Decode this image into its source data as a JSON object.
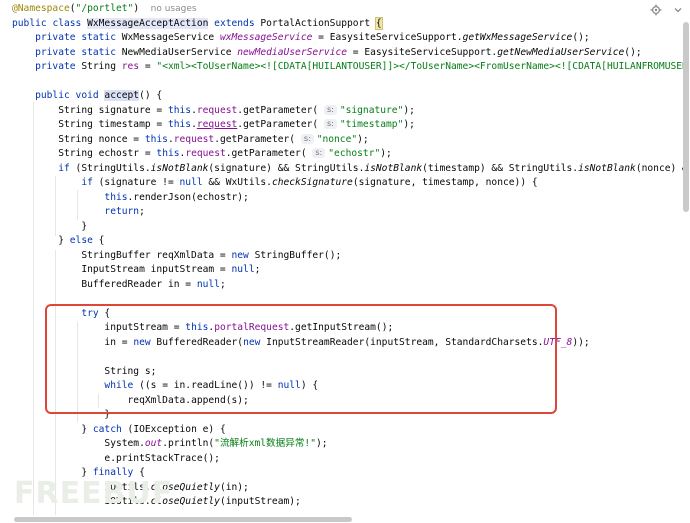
{
  "code": {
    "ann_name": "@Namespace",
    "ann_open": "(",
    "ann_value": "\"/portlet\"",
    "ann_close": ")",
    "usages": "no usages",
    "l2": {
      "public": "public ",
      "class": "class ",
      "name": "WxMessageAcceptAction",
      "extends": " extends ",
      "parent": "PortalActionSupport ",
      "brace": "{"
    },
    "l3": {
      "mods": "private static ",
      "type": "WxMessageService ",
      "field": "wxMessageService",
      "rest1": " = EasysiteServiceSupport.",
      "call": "getWxMessageService",
      "rest2": "();"
    },
    "l4": {
      "mods": "private static ",
      "type": "NewMediaUserService ",
      "field": "newMediaUserService",
      "rest1": " = EasysiteServiceSupport.",
      "call": "getNewMediaUserService",
      "rest2": "();"
    },
    "l5": {
      "mods": "private ",
      "type": "String ",
      "field": "res",
      "rest1": " = ",
      "str": "\"<xml><ToUserName><![CDATA[HUILANTOUSER]]></ToUserName><FromUserName><![CDATA[HUILANFROMUSER]]></FromUserN"
    },
    "l7": {
      "mods": "public void ",
      "method": "accept",
      "rest": "() {"
    },
    "l8": {
      "a": "String signature = ",
      "this": "this",
      "dot": ".",
      "req": "request",
      "call": ".getParameter( ",
      "hint": "s:",
      "arg": "\"signature\"",
      "end": ");"
    },
    "l9": {
      "a": "String timestamp = ",
      "this": "this",
      "dot": ".",
      "req": "request",
      "call": ".getParameter( ",
      "hint": "s:",
      "arg": "\"timestamp\"",
      "end": ");"
    },
    "l10": {
      "a": "String nonce = ",
      "this": "this",
      "dot": ".",
      "req": "request",
      "call": ".getParameter( ",
      "hint": "s:",
      "arg": "\"nonce\"",
      "end": ");"
    },
    "l11": {
      "a": "String echostr = ",
      "this": "this",
      "dot": ".",
      "req": "request",
      "call": ".getParameter( ",
      "hint": "s:",
      "arg": "\"echostr\"",
      "end": ");"
    },
    "l12": {
      "if": "if ",
      "a": "(StringUtils.",
      "m1": "isNotBlank",
      "b": "(signature) && StringUtils.",
      "m2": "isNotBlank",
      "c": "(timestamp) && StringUtils.",
      "m3": "isNotBlank",
      "d": "(nonce) && StringUtils."
    },
    "l13": {
      "if": "if ",
      "a": "(signature != ",
      "null": "null",
      "b": " && WxUtils.",
      "m": "checkSignature",
      "c": "(signature, timestamp, nonce)) {"
    },
    "l14": {
      "this": "this",
      "rest": ".renderJson(echostr);"
    },
    "l15": {
      "kw": "return",
      "rest": ";"
    },
    "l16": "}",
    "l17": {
      "a": "} ",
      "else": "else",
      "b": " {"
    },
    "l18": {
      "a": "StringBuffer reqXmlData = ",
      "new": "new",
      "b": " StringBuffer();"
    },
    "l19": {
      "a": "InputStream inputStream = ",
      "null": "null",
      "b": ";"
    },
    "l20": {
      "a": "BufferedReader in = ",
      "null": "null",
      "b": ";"
    },
    "l22": {
      "kw": "try",
      "rest": " {"
    },
    "l23": {
      "a": "inputStream = ",
      "this": "this",
      "dot": ".",
      "field": "portalRequest",
      "b": ".getInputStream();"
    },
    "l24": {
      "a": "in = ",
      "new1": "new",
      "b": " BufferedReader(",
      "new2": "new",
      "c": " InputStreamReader(inputStream, StandardCharsets.",
      "cs": "UTF_8",
      "d": "));"
    },
    "l26": "String s;",
    "l27": {
      "kw": "while",
      "a": " ((s = in.readLine()) != ",
      "null": "null",
      "b": ") {"
    },
    "l28": "reqXmlData.append(s);",
    "l29": "}",
    "l30": {
      "a": "} ",
      "kw": "catch",
      "b": " (IOException e) {"
    },
    "l31": {
      "a": "System.",
      "out": "out",
      "b": ".println(",
      "str": "\"流解析xml数据异常!\"",
      "c": ");"
    },
    "l32": "e.printStackTrace();",
    "l33": {
      "a": "} ",
      "kw": "finally",
      "b": " {"
    },
    "l34": {
      "a": "IOUtils.",
      "m": "closeQuietly",
      "b": "(in);"
    },
    "l35": {
      "a": "IOUtils.",
      "m": "closeQuietly",
      "b": "(inputStream);"
    }
  },
  "watermark": "FREEBUF",
  "icons": {
    "settings": "gear-icon",
    "collapse": "chevron-down-icon"
  },
  "colors": {
    "keyword": "#0033b3",
    "string": "#067d17",
    "field": "#871094",
    "annotation": "#9e880d",
    "highlight_box": "#e0453a"
  }
}
